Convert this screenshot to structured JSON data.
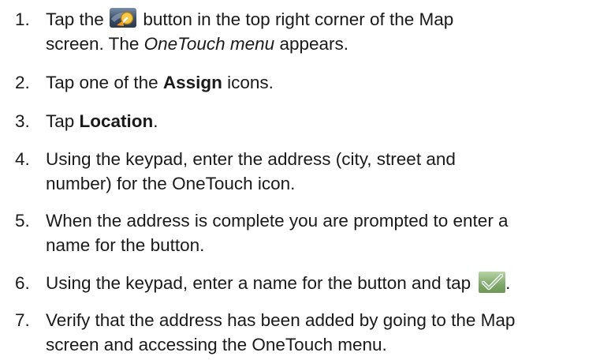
{
  "steps": [
    {
      "number": "1.",
      "line1_before_icon": "Tap the ",
      "icon": "onetouch-menu-icon",
      "line1_after_icon": " button in the top right corner of the Map",
      "line2_start": "screen. The ",
      "line2_italic": "OneTouch menu",
      "line2_end": " appears."
    },
    {
      "number": "2.",
      "before_bold": "Tap one of the ",
      "bold": "Assign",
      "after_bold": " icons."
    },
    {
      "number": "3.",
      "before_bold": "Tap ",
      "bold": "Location",
      "after_bold": "."
    },
    {
      "number": "4.",
      "line1": "Using the keypad, enter the address (city, street and",
      "line2": "number) for the OneTouch icon."
    },
    {
      "number": "5.",
      "line1": "When the address is complete you are prompted to enter a",
      "line2": "name for the button."
    },
    {
      "number": "6.",
      "text_before_icon": "Using the keypad, enter a name for the button and tap",
      "icon": "checkmark-icon",
      "text_after_icon": "."
    },
    {
      "number": "7.",
      "line1": "Verify that the address has been added by going to the Map",
      "line2": "screen and accessing the OneTouch menu."
    }
  ]
}
